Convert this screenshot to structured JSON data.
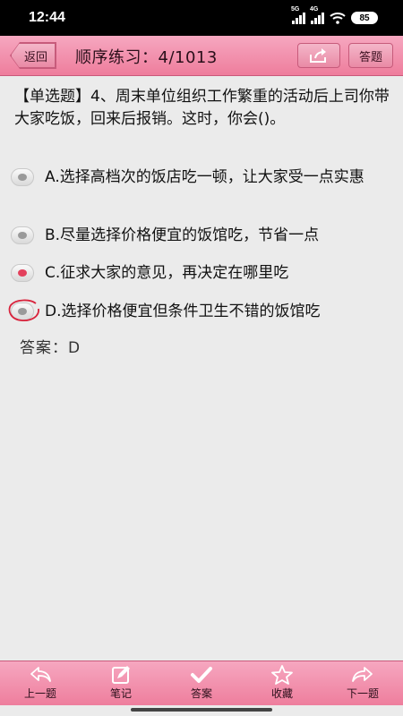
{
  "status_bar": {
    "time": "12:44",
    "net1": "5G",
    "net2": "4G",
    "battery": "85"
  },
  "header": {
    "back_label": "返回",
    "title": "顺序练习：4/1013",
    "answer_sheet_label": "答题"
  },
  "question": {
    "text": "【单选题】4、周末单位组织工作繁重的活动后上司你带大家吃饭，回来后报销。这时，你会()。",
    "options": [
      {
        "label": "A.选择高档次的饭店吃一顿，让大家受一点实惠",
        "selected": false
      },
      {
        "label": "B.尽量选择价格便宜的饭馆吃，节省一点",
        "selected": false
      },
      {
        "label": "C.征求大家的意见，再决定在哪里吃",
        "selected": true
      },
      {
        "label": "D.选择价格便宜但条件卫生不错的饭馆吃",
        "selected": false,
        "marked_correct": true
      }
    ],
    "answer_text": "答案：D"
  },
  "toolbar": {
    "items": [
      {
        "label": "上一题",
        "icon": "prev-arrow-icon"
      },
      {
        "label": "笔记",
        "icon": "note-icon"
      },
      {
        "label": "答案",
        "icon": "check-icon"
      },
      {
        "label": "收藏",
        "icon": "star-icon"
      },
      {
        "label": "下一题",
        "icon": "next-arrow-icon"
      }
    ]
  },
  "colors": {
    "accent_pink": "#ee7d9c",
    "selected_red": "#e3405c",
    "background": "#ebebeb"
  }
}
